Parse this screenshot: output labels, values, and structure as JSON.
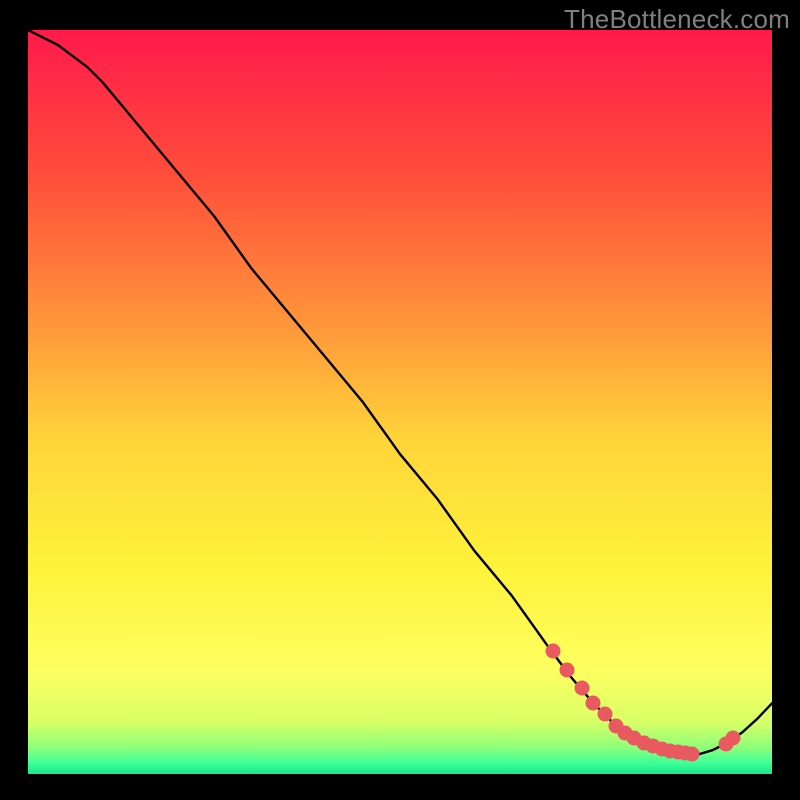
{
  "attribution": "TheBottleneck.com",
  "colors": {
    "gradient_stops": [
      {
        "offset": 0.0,
        "color": "#ff1a4b"
      },
      {
        "offset": 0.2,
        "color": "#ff4f3a"
      },
      {
        "offset": 0.4,
        "color": "#ff983a"
      },
      {
        "offset": 0.55,
        "color": "#ffd43a"
      },
      {
        "offset": 0.72,
        "color": "#fff23a"
      },
      {
        "offset": 0.86,
        "color": "#fdff60"
      },
      {
        "offset": 0.93,
        "color": "#d8ff66"
      },
      {
        "offset": 0.965,
        "color": "#8cff7a"
      },
      {
        "offset": 0.985,
        "color": "#3fff99"
      },
      {
        "offset": 1.0,
        "color": "#17e88a"
      }
    ],
    "curve": "#000000",
    "dots": "#e85a5f",
    "background": "#000000",
    "attribution_text": "#808080"
  },
  "chart_data": {
    "type": "line",
    "title": "",
    "xlabel": "",
    "ylabel": "",
    "xlim": [
      0,
      100
    ],
    "ylim": [
      0,
      100
    ],
    "series": [
      {
        "name": "curve",
        "x": [
          0,
          4,
          8,
          10,
          15,
          20,
          25,
          30,
          35,
          40,
          45,
          50,
          55,
          60,
          65,
          70,
          73,
          76,
          79,
          82,
          85,
          88,
          90,
          92,
          94,
          96,
          98,
          100
        ],
        "y": [
          100,
          98,
          95,
          93,
          87,
          81,
          75,
          68,
          62,
          56,
          50,
          43,
          37,
          30,
          24,
          17,
          13,
          9.5,
          6.5,
          4.5,
          3.3,
          2.7,
          2.6,
          3.2,
          4.2,
          5.6,
          7.4,
          9.5
        ]
      }
    ],
    "highlight_points": {
      "name": "dots",
      "x": [
        70.5,
        72.5,
        74.5,
        76.0,
        77.5,
        79.0,
        80.2,
        81.5,
        82.8,
        84.0,
        85.2,
        86.3,
        87.3,
        88.3,
        89.3,
        93.8,
        94.8
      ],
      "y": [
        16.5,
        14.0,
        11.5,
        9.5,
        8.0,
        6.5,
        5.5,
        4.8,
        4.2,
        3.7,
        3.4,
        3.1,
        2.9,
        2.8,
        2.7,
        4.0,
        4.8
      ]
    }
  }
}
